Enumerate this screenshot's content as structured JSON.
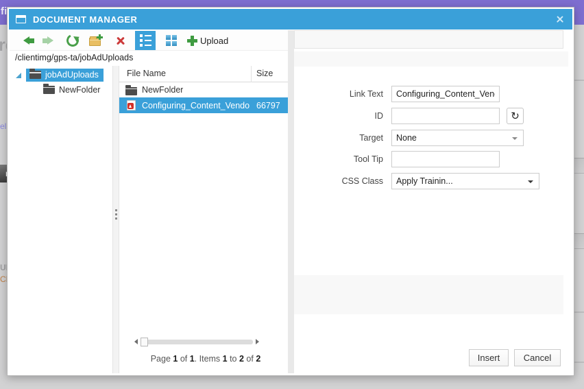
{
  "colors": {
    "titlebar_blue": "#3AA0D9",
    "selection_blue": "#3AA0D9",
    "toolbar_green": "#3F9B41",
    "delete_red": "#CC3A3A",
    "folder_yellow": "#E9BF63",
    "background_purple": "#7E6ED0"
  },
  "background": {
    "header_fragment": "fic",
    "heading_fragment": "re",
    "link_fragment": "el:",
    "button_fragment": "rn",
    "label_fragment_ui": "UI'",
    "label_fragment_cri": "CRI"
  },
  "window": {
    "title": "DOCUMENT MANAGER",
    "toolbar": {
      "upload_label": "Upload"
    },
    "path": "/clientimg/gps-ta/jobAdUploads",
    "tree": {
      "root_label": "jobAdUploads",
      "child_label": "NewFolder"
    },
    "grid": {
      "columns": {
        "name": "File Name",
        "size": "Size"
      },
      "rows": [
        {
          "name": "NewFolder",
          "size": "",
          "type": "folder",
          "selected": false
        },
        {
          "name": "Configuring_Content_Vendo",
          "size": "66797",
          "type": "pdf",
          "selected": true
        }
      ],
      "pager": {
        "segments": [
          {
            "text": "Page "
          },
          {
            "text": "1",
            "bold": true
          },
          {
            "text": " of "
          },
          {
            "text": "1",
            "bold": true
          },
          {
            "text": ". Items "
          },
          {
            "text": "1",
            "bold": true
          },
          {
            "text": " to "
          },
          {
            "text": "2",
            "bold": true
          },
          {
            "text": " of "
          },
          {
            "text": "2",
            "bold": true
          }
        ]
      }
    },
    "form": {
      "fields": [
        {
          "label": "Link Text",
          "value": "Configuring_Content_Vendor",
          "control": "input"
        },
        {
          "label": "ID",
          "value": "",
          "control": "input_with_refresh"
        },
        {
          "label": "Target",
          "value": "None",
          "control": "select"
        },
        {
          "label": "Tool Tip",
          "value": "",
          "control": "input"
        },
        {
          "label": "CSS Class",
          "value": "Apply Trainin...",
          "control": "select"
        }
      ],
      "refresh_glyph": "↻"
    },
    "footer": {
      "insert_label": "Insert",
      "cancel_label": "Cancel"
    }
  }
}
